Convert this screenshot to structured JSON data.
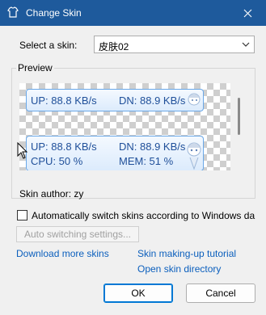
{
  "window": {
    "title": "Change Skin",
    "close_icon": "close-icon",
    "app_icon": "skin-icon"
  },
  "skin_select": {
    "label": "Select a skin:",
    "value": "皮肤02"
  },
  "preview": {
    "label": "Preview",
    "skin1": {
      "up": "UP: 88.8 KB/s",
      "dn": "DN: 88.9 KB/s"
    },
    "skin2": {
      "up": "UP: 88.8 KB/s",
      "dn": "DN: 88.9 KB/s",
      "cpu": "CPU: 50 %",
      "mem": "MEM: 51 %"
    }
  },
  "author": "Skin author: zy",
  "auto_switch": {
    "checkbox_label": "Automatically switch skins according to Windows da",
    "checked": false,
    "settings_button": "Auto switching settings..."
  },
  "links": {
    "download": "Download more skins",
    "tutorial": "Skin making-up tutorial",
    "open_dir": "Open skin directory"
  },
  "buttons": {
    "ok": "OK",
    "cancel": "Cancel"
  },
  "colors": {
    "titlebar": "#1e5a9c",
    "link": "#0b5fbd",
    "skin_text": "#1f4f99",
    "accent": "#0078d4"
  }
}
